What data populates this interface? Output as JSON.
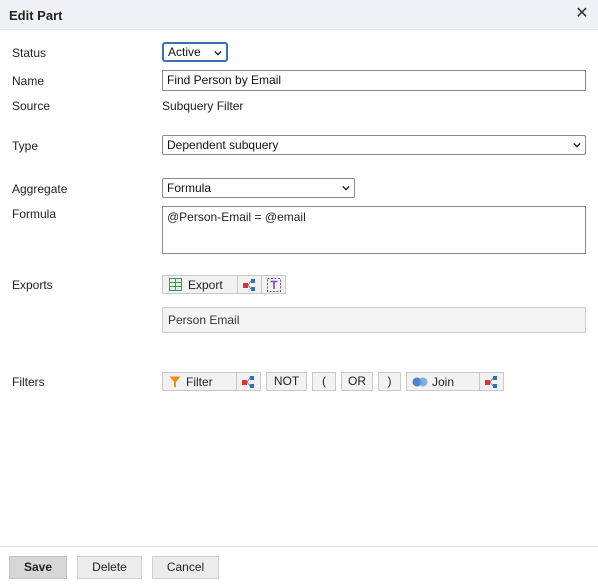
{
  "dialog": {
    "title": "Edit Part"
  },
  "form": {
    "status": {
      "label": "Status",
      "value": "Active"
    },
    "name": {
      "label": "Name",
      "value": "Find Person by Email"
    },
    "source": {
      "label": "Source",
      "value": "Subquery Filter"
    },
    "type": {
      "label": "Type",
      "value": "Dependent subquery"
    },
    "aggregate": {
      "label": "Aggregate",
      "value": "Formula"
    },
    "formula": {
      "label": "Formula",
      "value": "@Person-Email = @email"
    },
    "exports": {
      "label": "Exports",
      "export_button": "Export",
      "item": "Person Email"
    },
    "filters": {
      "label": "Filters",
      "filter_button": "Filter",
      "not_button": "NOT",
      "open_paren_button": "(",
      "or_button": "OR",
      "close_paren_button": ")",
      "join_button": "Join"
    }
  },
  "footer": {
    "save": "Save",
    "delete": "Delete",
    "cancel": "Cancel"
  },
  "colors": {
    "accent_blue": "#3f6fb5",
    "titlebar_bg": "#eef1f5",
    "icon_red": "#d9343a",
    "icon_blue": "#2f6ec4",
    "icon_orange": "#e8901a",
    "icon_purple": "#7b4bb7",
    "icon_green": "#3a9a55"
  },
  "icons": {
    "close": "close-icon",
    "table": "table-icon",
    "relation": "relation-icon",
    "text": "text-icon",
    "funnel": "funnel-icon",
    "join": "join-icon",
    "caret": "chevron-down-icon"
  }
}
